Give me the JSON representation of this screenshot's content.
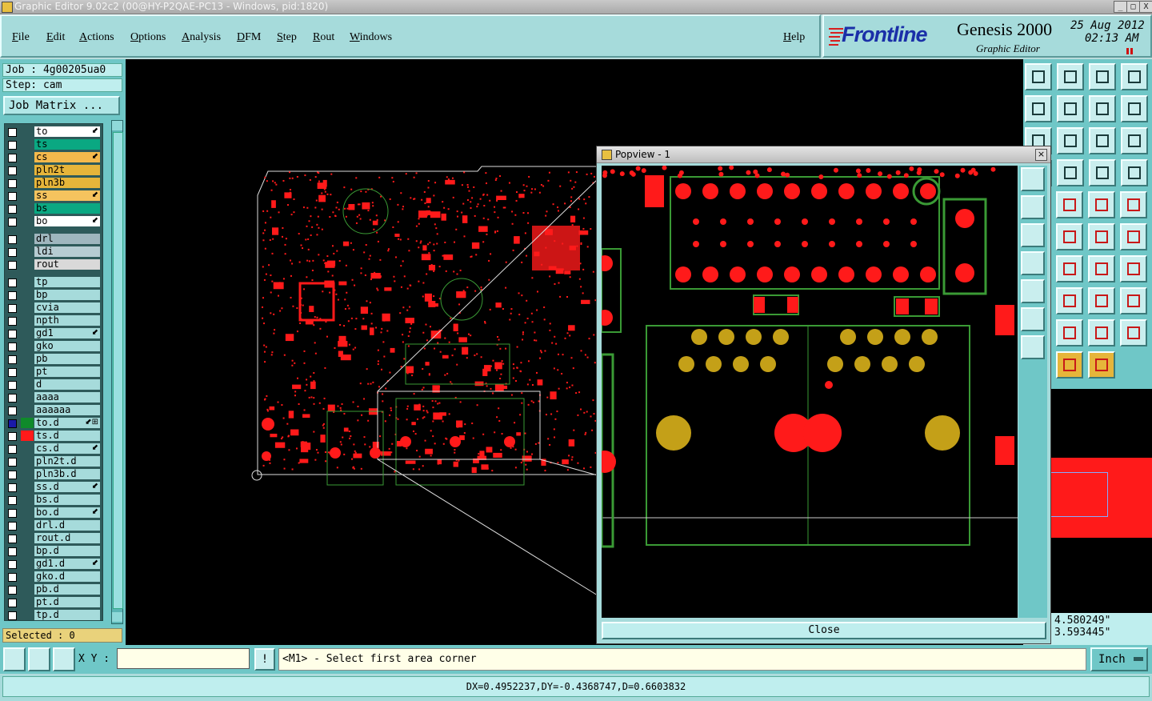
{
  "window": {
    "title": "Graphic Editor 9.02c2 (00@HY-P2QAE-PC13 - Windows, pid:1820)",
    "buttons": [
      "_",
      "□",
      "X"
    ]
  },
  "menubar": {
    "items": [
      "File",
      "Edit",
      "Actions",
      "Options",
      "Analysis",
      "DFM",
      "Step",
      "Rout",
      "Windows"
    ],
    "help": "Help"
  },
  "logo": {
    "brand": "Frontline",
    "product": "Genesis 2000",
    "subtitle": "Graphic Editor",
    "date": "25 Aug 2012",
    "time": "02:13 AM"
  },
  "left": {
    "job": "Job : 4g00205ua0",
    "step": "Step: cam",
    "job_matrix": "Job Matrix ...",
    "selected": "Selected : 0"
  },
  "layers": [
    {
      "name": "to",
      "bg": "#ffffff",
      "mark": "⬋"
    },
    {
      "name": "ts",
      "bg": "#0aa882",
      "mark": ""
    },
    {
      "name": "cs",
      "bg": "#f5b94c",
      "mark": "⬋"
    },
    {
      "name": "pln2t",
      "bg": "#e6b53a",
      "mark": ""
    },
    {
      "name": "pln3b",
      "bg": "#e6b53a",
      "mark": ""
    },
    {
      "name": "ss",
      "bg": "#f5c35e",
      "mark": "⬋"
    },
    {
      "name": "bs",
      "bg": "#0aa882",
      "mark": ""
    },
    {
      "name": "bo",
      "bg": "#ffffff",
      "mark": "⬋"
    },
    {
      "name": "drl",
      "bg": "#9fb6be",
      "mark": ""
    },
    {
      "name": "ldi",
      "bg": "#b6ccd2",
      "mark": ""
    },
    {
      "name": "rout",
      "bg": "#d9d9d9",
      "mark": ""
    },
    {
      "name": "tp",
      "bg": "#a6dbdb",
      "mark": ""
    },
    {
      "name": "bp",
      "bg": "#a6dbdb",
      "mark": ""
    },
    {
      "name": "cvia",
      "bg": "#a6dbdb",
      "mark": ""
    },
    {
      "name": "npth",
      "bg": "#a6dbdb",
      "mark": ""
    },
    {
      "name": "gd1",
      "bg": "#a6dbdb",
      "mark": "⬋"
    },
    {
      "name": "gko",
      "bg": "#a6dbdb",
      "mark": ""
    },
    {
      "name": "pb",
      "bg": "#a6dbdb",
      "mark": ""
    },
    {
      "name": "pt",
      "bg": "#a6dbdb",
      "mark": ""
    },
    {
      "name": "d",
      "bg": "#a6dbdb",
      "mark": ""
    },
    {
      "name": "aaaa",
      "bg": "#a6dbdb",
      "mark": ""
    },
    {
      "name": "aaaaaa",
      "bg": "#a6dbdb",
      "mark": ""
    },
    {
      "name": "to.d",
      "bg": "#a6dbdb",
      "mark": "⬋⊞",
      "swatch": "#0f8a2a",
      "chk": "#1a1aa8"
    },
    {
      "name": "ts.d",
      "bg": "#a6dbdb",
      "mark": "",
      "swatch": "#ff1a1a"
    },
    {
      "name": "cs.d",
      "bg": "#a6dbdb",
      "mark": "⬋"
    },
    {
      "name": "pln2t.d",
      "bg": "#a6dbdb",
      "mark": ""
    },
    {
      "name": "pln3b.d",
      "bg": "#a6dbdb",
      "mark": ""
    },
    {
      "name": "ss.d",
      "bg": "#a6dbdb",
      "mark": "⬋"
    },
    {
      "name": "bs.d",
      "bg": "#a6dbdb",
      "mark": ""
    },
    {
      "name": "bo.d",
      "bg": "#a6dbdb",
      "mark": "⬋"
    },
    {
      "name": "drl.d",
      "bg": "#a6dbdb",
      "mark": ""
    },
    {
      "name": "rout.d",
      "bg": "#a6dbdb",
      "mark": ""
    },
    {
      "name": "bp.d",
      "bg": "#a6dbdb",
      "mark": ""
    },
    {
      "name": "gd1.d",
      "bg": "#a6dbdb",
      "mark": "⬋"
    },
    {
      "name": "gko.d",
      "bg": "#a6dbdb",
      "mark": ""
    },
    {
      "name": "pb.d",
      "bg": "#a6dbdb",
      "mark": ""
    },
    {
      "name": "pt.d",
      "bg": "#a6dbdb",
      "mark": ""
    },
    {
      "name": "tp.d",
      "bg": "#a6dbdb",
      "mark": ""
    }
  ],
  "popview": {
    "title": "Popview - 1",
    "close": "Close"
  },
  "coords": {
    "x": "4.580249\"",
    "y": "3.593445\""
  },
  "cmd": {
    "xy_label": "X Y :",
    "xy_value": "",
    "prompt": "<M1> - Select first area corner",
    "units": "Inch"
  },
  "status": {
    "text": "DX=0.4952237,DY=-0.4368747,D=0.6603832"
  },
  "toolbar_icons": [
    "zoom-home-icon",
    "snapshot-icon",
    "home-icon",
    "split-icon",
    "step-in-icon",
    "step-out-icon",
    "undo-icon",
    "redraw-icon",
    "center-icon",
    "fit-icon",
    "one-to-one-icon",
    "help-icon",
    "measure-icon",
    "graph-icon",
    "graph2-icon",
    "line-tool-icon",
    "ruler-icon",
    "pad-icon",
    "cross-icon",
    "vector-icon",
    "vector2-icon",
    "draw-line-icon",
    "arc-icon",
    "net-icon",
    "move-icon",
    "reshape-icon",
    "pads-icon",
    "triangle-icon",
    "triangle2-icon",
    "triangle3-icon",
    "select-icon",
    "select2-icon",
    "select3-icon"
  ],
  "colors": {
    "pcb_red": "#ff1a1a",
    "pcb_green": "#3a9a35",
    "pcb_gold": "#c4a018",
    "panel": "#6fc7c7",
    "panel_light": "#a6dbdb"
  }
}
